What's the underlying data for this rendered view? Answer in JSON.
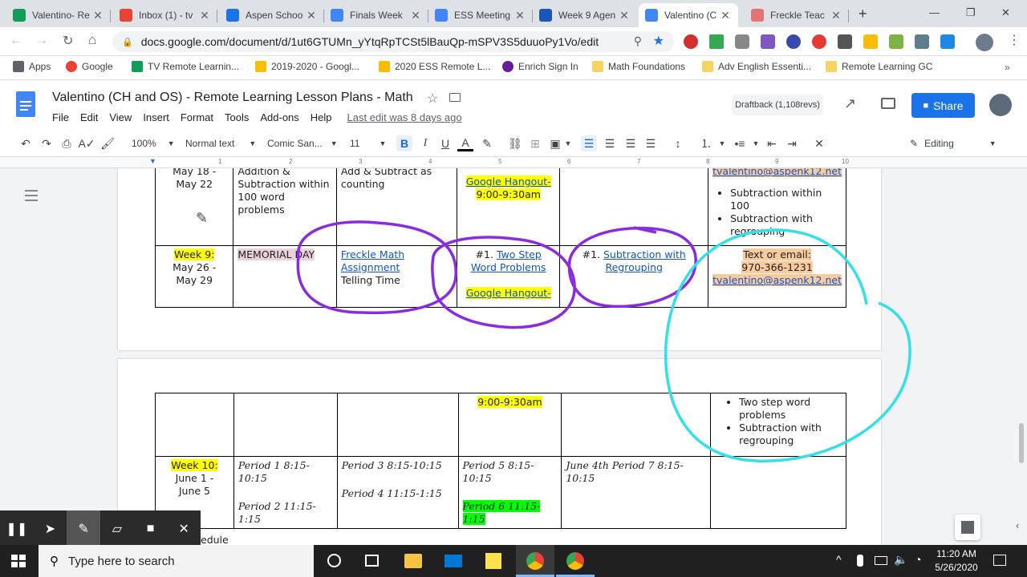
{
  "browser": {
    "tabs": [
      {
        "title": "Valentino- Re",
        "color": "#0f9d58",
        "icon": "sheets-icon"
      },
      {
        "title": "Inbox (1) - tv",
        "color": "#ea4335",
        "icon": "gmail-icon"
      },
      {
        "title": "Aspen Schoo",
        "color": "#1a73e8",
        "icon": "calendar-icon"
      },
      {
        "title": "Finals Week",
        "color": "#4285f4",
        "icon": "docs-icon"
      },
      {
        "title": "ESS Meeting",
        "color": "#4285f4",
        "icon": "docs-icon"
      },
      {
        "title": "Week 9 Agen",
        "color": "#1a56b8",
        "icon": "account-icon"
      },
      {
        "title": "Valentino (C",
        "color": "#4285f4",
        "icon": "docs-icon"
      },
      {
        "title": "Freckle Teac",
        "color": "#e57373",
        "icon": "freckle-icon"
      }
    ],
    "url": "docs.google.com/document/d/1ut6GTUMn_yYtqRpTCSt5lBauQp-mSPV3S5duuoPy1Vo/edit",
    "bookmarks": [
      "Apps",
      "Google",
      "TV Remote Learnin...",
      "2019-2020 - Googl...",
      "2020 ESS Remote L...",
      "Enrich Sign In",
      "Math Foundations",
      "Adv English Essenti...",
      "Remote Learning GC"
    ]
  },
  "doc": {
    "title": "Valentino (CH and OS) - Remote Learning Lesson Plans - Math",
    "menu": [
      "File",
      "Edit",
      "View",
      "Insert",
      "Format",
      "Tools",
      "Add-ons",
      "Help"
    ],
    "last_edit": "Last edit was 8 days ago",
    "draftback": "Draftback (1,108revs)",
    "share": "Share",
    "zoom": "100%",
    "style": "Normal text",
    "font": "Comic San...",
    "size": "11",
    "mode": "Editing",
    "ruler_numbers": [
      "1",
      "2",
      "3",
      "4",
      "5",
      "6",
      "7",
      "8",
      "9",
      "10"
    ]
  },
  "table1": {
    "row1": {
      "week": "May 18 -\nMay 22",
      "c2": "Addition & Subtraction within 100 word problems",
      "c3": "Add & Subtract as counting",
      "c4a": "Google Hangout-",
      "c4b": "9:00-9:30am",
      "email": "tvalentino@aspenk12.net",
      "b1": "Subtraction within 100",
      "b2": "Subtraction with regrouping"
    },
    "row2": {
      "week_label": "Week 9:",
      "week_dates": "May 26 -\nMay 29",
      "c2": "MEMORIAL DAY",
      "c3_link1": "Freckle Math",
      "c3_link2": "Assignment",
      "c3_text": "Telling Time",
      "c4_prefix": "#1.",
      "c4_link1": "Two Step",
      "c4_link2": "Word Problems",
      "c4_hangout": "Google Hangout-",
      "c5_prefix": "#1.",
      "c5_link1": "Subtraction with",
      "c5_link2": "Regrouping",
      "c6_text1": "Text or email:",
      "c6_phone": "970-366-1231",
      "c6_email": "tvalentino@aspenk12.net"
    }
  },
  "table2": {
    "row1": {
      "c4": "9:00-9:30am",
      "b1": "Two step word problems",
      "b2": "Subtraction with regrouping"
    },
    "row2": {
      "week_label": "Week 10:",
      "week_dates": "June 1 -\nJune 5",
      "c2a": "Period 1 8:15-10:15",
      "c2b": "Period 2 11:15-1:15",
      "c3a": "Period 3 8:15-10:15",
      "c3b": "Period 4 11:15-1:15",
      "c4a": "Period 5 8:15-10:15",
      "c4b": "Period 6 11:15-1:15",
      "c5": "June 4th Period 7 8:15-10:15"
    }
  },
  "below_text": "edule",
  "taskbar": {
    "search": "Type here to search",
    "time": "11:20 AM",
    "date": "5/26/2020"
  },
  "colors": {
    "share": "#1a73e8",
    "annotation_purple": "#8a2be2",
    "annotation_cyan": "#33e0e8"
  }
}
